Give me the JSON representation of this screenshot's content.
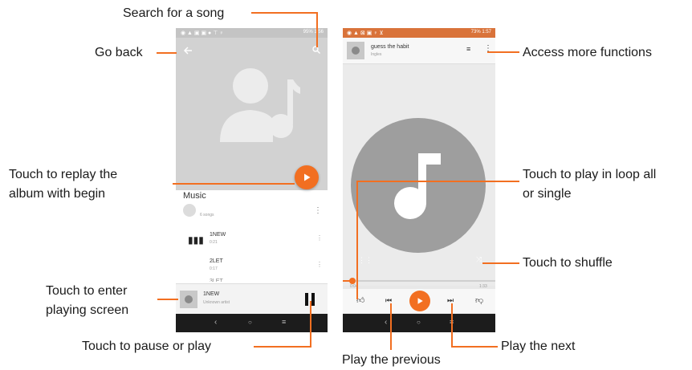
{
  "annotations": {
    "search_song": "Search for a song",
    "go_back": "Go back",
    "replay_album_line1": "Touch to replay the",
    "replay_album_line2": "album with begin",
    "enter_playing_line1": "Touch to enter",
    "enter_playing_line2": "playing screen",
    "pause_play": "Touch to pause or play",
    "more_functions": "Access more functions",
    "loop_line1": "Touch to play in loop all",
    "loop_line2": "or single",
    "shuffle": "Touch to shuffle",
    "play_next": "Play the next",
    "play_previous": "Play the previous"
  },
  "phone_left": {
    "status_right": "95% 1:56",
    "section_title": "Music",
    "song_count": "6 songs",
    "songs": [
      {
        "title": "1NEW",
        "duration": "0:21"
      },
      {
        "title": "2LET",
        "duration": "0:17"
      },
      {
        "title": "3LET",
        "duration": ""
      }
    ],
    "now_playing": {
      "title": "1NEW",
      "artist": "Unknown artist"
    }
  },
  "phone_right": {
    "status_right": "73% 1:57",
    "track_title": "guess the habit",
    "track_artist": "Ingles",
    "time_elapsed": "0:04",
    "time_total": "1:33"
  },
  "colors": {
    "accent": "#f26f21",
    "left_status_bar": "#c4c4c4",
    "right_status_bar": "#d9733a",
    "nav_bar": "#1c1c1c"
  },
  "icons": [
    "back-arrow-icon",
    "search-icon",
    "artist-placeholder-icon",
    "play-icon",
    "more-vert-icon",
    "album-icon",
    "pause-icon",
    "queue-icon",
    "music-note-icon",
    "repeat-icon",
    "shuffle-icon",
    "thumbs-up-icon",
    "skip-previous-icon",
    "skip-next-icon",
    "thumbs-down-icon"
  ]
}
